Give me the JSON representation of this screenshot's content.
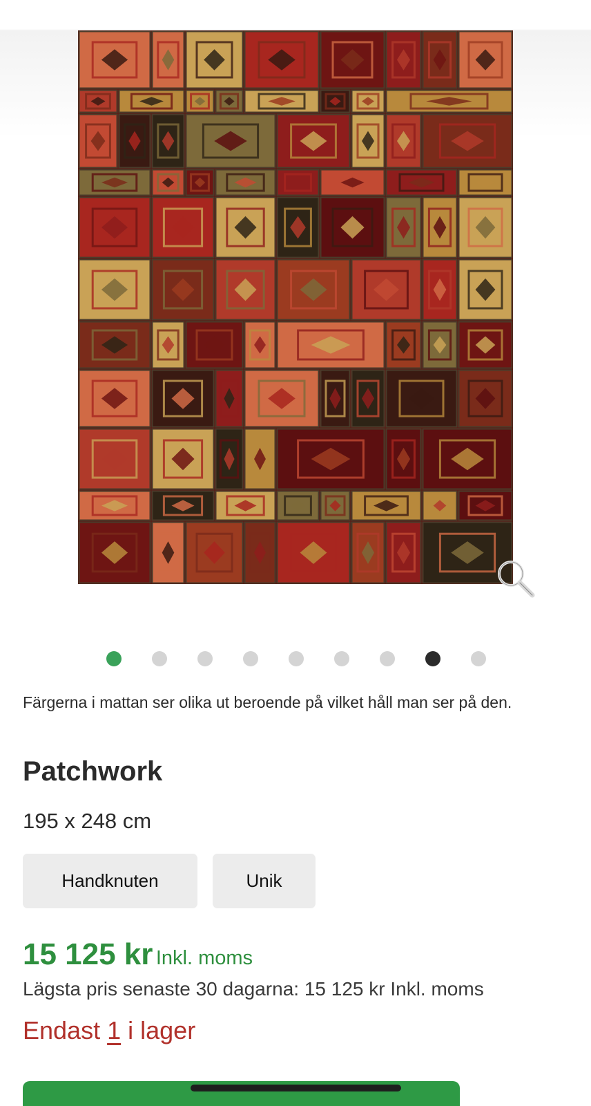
{
  "gallery": {
    "image_alt": "Patchwork",
    "dots_count": 9,
    "active_dot": 0,
    "dark_dot": 7,
    "zoom_icon": "magnifier-icon"
  },
  "product": {
    "description": "Färgerna i mattan ser olika ut beroende på vilket håll man ser på den.",
    "title": "Patchwork",
    "size": "195 x 248 cm",
    "tags": [
      "Handknuten",
      "Unik"
    ],
    "price": "15 125 kr",
    "price_vat": "Inkl. moms",
    "lowest_price": "Lägsta pris senaste 30 dagarna: 15 125 kr Inkl. moms",
    "stock_prefix": "Endast",
    "stock_qty": "1",
    "stock_suffix": "i lager"
  },
  "colors": {
    "price_green": "#2e8f3e",
    "stock_red": "#b1312b",
    "dot_active": "#3aa25a",
    "dot_inactive": "#d4d4d4",
    "dot_dark": "#2b2b2b",
    "button_green": "#2e9a45"
  }
}
